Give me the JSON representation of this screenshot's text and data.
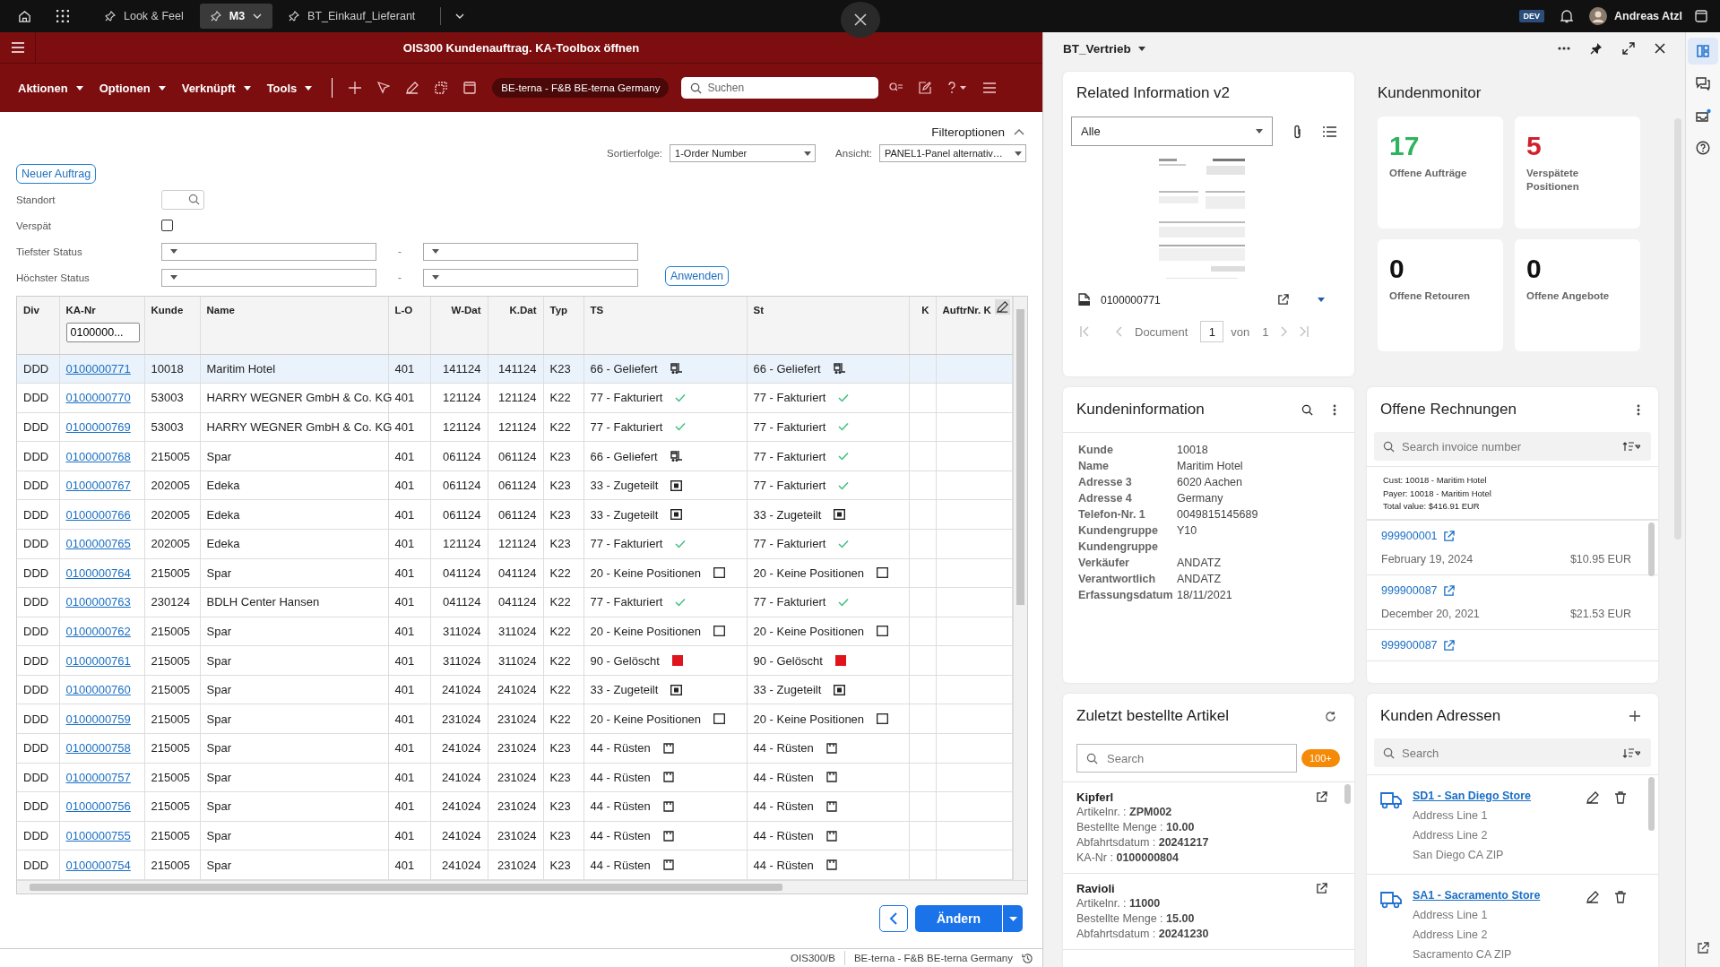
{
  "top_bar": {
    "tabs": [
      {
        "label": "Look & Feel",
        "selected": false
      },
      {
        "label": "M3",
        "selected": true
      },
      {
        "label": "BT_Einkauf_Lieferant",
        "selected": false
      }
    ],
    "env_badge": "DEV",
    "user": "Andreas Atzl"
  },
  "window": {
    "title": "OIS300 Kundenauftrag. KA-Toolbox öffnen"
  },
  "toolbar": {
    "menus": [
      "Aktionen",
      "Optionen",
      "Verknüpft",
      "Tools"
    ],
    "company": "BE-terna - F&B BE-terna Germany",
    "search": {
      "placeholder": "Suchen"
    }
  },
  "filters": {
    "toggle": "Filteroptionen",
    "expanded": true,
    "sort_label": "Sortierfolge:",
    "sort_value": "1-Order Number",
    "view_label": "Ansicht:",
    "view_value": "PANEL1-Panel alternativ…",
    "new_button": "Neuer Auftrag",
    "apply_button": "Anwenden",
    "fields": [
      {
        "label": "Standort",
        "kind": "search"
      },
      {
        "label": "Verspät",
        "kind": "checkbox",
        "checked": false
      },
      {
        "label": "Tiefster Status",
        "kind": "range",
        "separator": "-"
      },
      {
        "label": "Höchster Status",
        "kind": "range",
        "separator": "-"
      }
    ]
  },
  "table": {
    "columns": [
      "Div",
      "KA-Nr",
      "Kunde",
      "Name",
      "L-O",
      "W-Dat",
      "K.Dat",
      "Typ",
      "TS",
      "St",
      "K",
      "AuftrNr. K"
    ],
    "filter_value": "0100000...",
    "rows": [
      {
        "div": "DDD",
        "ka_nr": "0100000771",
        "kunde": "10018",
        "name": "Maritim Hotel",
        "lo": "401",
        "w_dat": "141124",
        "k_dat": "141124",
        "typ": "K23",
        "ts": {
          "label": "66 - Geliefert",
          "kind": "delivered"
        },
        "st": {
          "label": "66 - Geliefert",
          "kind": "delivered"
        },
        "selected": true
      },
      {
        "div": "DDD",
        "ka_nr": "0100000770",
        "kunde": "53003",
        "name": "HARRY WEGNER GmbH & Co. KG",
        "lo": "401",
        "w_dat": "121124",
        "k_dat": "121124",
        "typ": "K22",
        "ts": {
          "label": "77 - Fakturiert",
          "kind": "invoiced"
        },
        "st": {
          "label": "77 - Fakturiert",
          "kind": "invoiced"
        },
        "selected": false
      },
      {
        "div": "DDD",
        "ka_nr": "0100000769",
        "kunde": "53003",
        "name": "HARRY WEGNER GmbH & Co. KG",
        "lo": "401",
        "w_dat": "121124",
        "k_dat": "121124",
        "typ": "K22",
        "ts": {
          "label": "77 - Fakturiert",
          "kind": "invoiced"
        },
        "st": {
          "label": "77 - Fakturiert",
          "kind": "invoiced"
        },
        "selected": false
      },
      {
        "div": "DDD",
        "ka_nr": "0100000768",
        "kunde": "215005",
        "name": "Spar",
        "lo": "401",
        "w_dat": "061124",
        "k_dat": "061124",
        "typ": "K23",
        "ts": {
          "label": "66 - Geliefert",
          "kind": "delivered"
        },
        "st": {
          "label": "77 - Fakturiert",
          "kind": "invoiced"
        },
        "selected": false
      },
      {
        "div": "DDD",
        "ka_nr": "0100000767",
        "kunde": "202005",
        "name": "Edeka",
        "lo": "401",
        "w_dat": "061124",
        "k_dat": "061124",
        "typ": "K23",
        "ts": {
          "label": "33 - Zugeteilt",
          "kind": "assigned"
        },
        "st": {
          "label": "77 - Fakturiert",
          "kind": "invoiced"
        },
        "selected": false
      },
      {
        "div": "DDD",
        "ka_nr": "0100000766",
        "kunde": "202005",
        "name": "Edeka",
        "lo": "401",
        "w_dat": "061124",
        "k_dat": "061124",
        "typ": "K23",
        "ts": {
          "label": "33 - Zugeteilt",
          "kind": "assigned"
        },
        "st": {
          "label": "33 - Zugeteilt",
          "kind": "assigned"
        },
        "selected": false
      },
      {
        "div": "DDD",
        "ka_nr": "0100000765",
        "kunde": "202005",
        "name": "Edeka",
        "lo": "401",
        "w_dat": "121124",
        "k_dat": "121124",
        "typ": "K23",
        "ts": {
          "label": "77 - Fakturiert",
          "kind": "invoiced"
        },
        "st": {
          "label": "77 - Fakturiert",
          "kind": "invoiced"
        },
        "selected": false
      },
      {
        "div": "DDD",
        "ka_nr": "0100000764",
        "kunde": "215005",
        "name": "Spar",
        "lo": "401",
        "w_dat": "041124",
        "k_dat": "041124",
        "typ": "K22",
        "ts": {
          "label": "20 - Keine Positionen",
          "kind": "empty"
        },
        "st": {
          "label": "20 - Keine Positionen",
          "kind": "empty"
        },
        "selected": false
      },
      {
        "div": "DDD",
        "ka_nr": "0100000763",
        "kunde": "230124",
        "name": "BDLH Center Hansen",
        "lo": "401",
        "w_dat": "041124",
        "k_dat": "041124",
        "typ": "K22",
        "ts": {
          "label": "77 - Fakturiert",
          "kind": "invoiced"
        },
        "st": {
          "label": "77 - Fakturiert",
          "kind": "invoiced"
        },
        "selected": false
      },
      {
        "div": "DDD",
        "ka_nr": "0100000762",
        "kunde": "215005",
        "name": "Spar",
        "lo": "401",
        "w_dat": "311024",
        "k_dat": "311024",
        "typ": "K22",
        "ts": {
          "label": "20 - Keine Positionen",
          "kind": "empty"
        },
        "st": {
          "label": "20 - Keine Positionen",
          "kind": "empty"
        },
        "selected": false
      },
      {
        "div": "DDD",
        "ka_nr": "0100000761",
        "kunde": "215005",
        "name": "Spar",
        "lo": "401",
        "w_dat": "311024",
        "k_dat": "311024",
        "typ": "K22",
        "ts": {
          "label": "90 - Gelöscht",
          "kind": "deleted"
        },
        "st": {
          "label": "90 - Gelöscht",
          "kind": "deleted"
        },
        "selected": false
      },
      {
        "div": "DDD",
        "ka_nr": "0100000760",
        "kunde": "215005",
        "name": "Spar",
        "lo": "401",
        "w_dat": "241024",
        "k_dat": "241024",
        "typ": "K22",
        "ts": {
          "label": "33 - Zugeteilt",
          "kind": "assigned"
        },
        "st": {
          "label": "33 - Zugeteilt",
          "kind": "assigned"
        },
        "selected": false
      },
      {
        "div": "DDD",
        "ka_nr": "0100000759",
        "kunde": "215005",
        "name": "Spar",
        "lo": "401",
        "w_dat": "231024",
        "k_dat": "231024",
        "typ": "K22",
        "ts": {
          "label": "20 - Keine Positionen",
          "kind": "empty"
        },
        "st": {
          "label": "20 - Keine Positionen",
          "kind": "empty"
        },
        "selected": false
      },
      {
        "div": "DDD",
        "ka_nr": "0100000758",
        "kunde": "215005",
        "name": "Spar",
        "lo": "401",
        "w_dat": "241024",
        "k_dat": "231024",
        "typ": "K23",
        "ts": {
          "label": "44 - Rüsten",
          "kind": "picking"
        },
        "st": {
          "label": "44 - Rüsten",
          "kind": "picking"
        },
        "selected": false
      },
      {
        "div": "DDD",
        "ka_nr": "0100000757",
        "kunde": "215005",
        "name": "Spar",
        "lo": "401",
        "w_dat": "241024",
        "k_dat": "231024",
        "typ": "K23",
        "ts": {
          "label": "44 - Rüsten",
          "kind": "picking"
        },
        "st": {
          "label": "44 - Rüsten",
          "kind": "picking"
        },
        "selected": false
      },
      {
        "div": "DDD",
        "ka_nr": "0100000756",
        "kunde": "215005",
        "name": "Spar",
        "lo": "401",
        "w_dat": "241024",
        "k_dat": "231024",
        "typ": "K23",
        "ts": {
          "label": "44 - Rüsten",
          "kind": "picking"
        },
        "st": {
          "label": "44 - Rüsten",
          "kind": "picking"
        },
        "selected": false
      },
      {
        "div": "DDD",
        "ka_nr": "0100000755",
        "kunde": "215005",
        "name": "Spar",
        "lo": "401",
        "w_dat": "241024",
        "k_dat": "231024",
        "typ": "K23",
        "ts": {
          "label": "44 - Rüsten",
          "kind": "picking"
        },
        "st": {
          "label": "44 - Rüsten",
          "kind": "picking"
        },
        "selected": false
      },
      {
        "div": "DDD",
        "ka_nr": "0100000754",
        "kunde": "215005",
        "name": "Spar",
        "lo": "401",
        "w_dat": "241024",
        "k_dat": "231024",
        "typ": "K23",
        "ts": {
          "label": "44 - Rüsten",
          "kind": "picking"
        },
        "st": {
          "label": "44 - Rüsten",
          "kind": "picking"
        },
        "selected": false
      }
    ]
  },
  "actions": {
    "primary": "Ändern"
  },
  "status_bar": {
    "program": "OIS300/B",
    "company": "BE-terna - F&B BE-terna Germany"
  },
  "side_panel": {
    "title": "BT_Vertrieb",
    "related": {
      "title": "Related Information v2",
      "filter": "Alle",
      "file": "0100000771",
      "pager_label": "Document",
      "page": "1",
      "of_label": "von",
      "pages": "1"
    },
    "monitor": {
      "title": "Kundenmonitor",
      "tiles": [
        {
          "value": "17",
          "label": "Offene Aufträge",
          "color": "#2fb35f"
        },
        {
          "value": "5",
          "label": "Verspätete Positionen",
          "color": "#d0202a"
        },
        {
          "value": "0",
          "label": "Offene Retouren",
          "color": "#111111"
        },
        {
          "value": "0",
          "label": "Offene Angebote",
          "color": "#111111"
        }
      ]
    },
    "customer_info": {
      "title": "Kundeninformation",
      "fields": [
        {
          "label": "Kunde",
          "value": "10018"
        },
        {
          "label": "Name",
          "value": "Maritim Hotel"
        },
        {
          "label": "Adresse 3",
          "value": "6020 Aachen"
        },
        {
          "label": "Adresse 4",
          "value": "Germany"
        },
        {
          "label": "Telefon-Nr. 1",
          "value": "0049815145689"
        },
        {
          "label": "Kundengruppe",
          "value": "Y10"
        },
        {
          "label": "Kundengruppe"
        },
        {
          "label": "Verkäufer",
          "value": "ANDATZ"
        },
        {
          "label": "Verantwortlich",
          "value": "ANDATZ"
        },
        {
          "label": "Erfassungsdatum",
          "value": "18/11/2021"
        }
      ]
    },
    "invoices": {
      "title": "Offene Rechnungen",
      "search": {
        "placeholder": "Search invoice number"
      },
      "summary": [
        "Cust: 10018 - Maritim Hotel",
        "Payer: 10018 - Maritim Hotel",
        "Total value: $416.91 EUR"
      ],
      "items": [
        {
          "number": "999900001",
          "date": "February 19, 2024",
          "amount": "$10.95 EUR"
        },
        {
          "number": "999900087",
          "date": "December 20, 2021",
          "amount": "$21.53 EUR"
        },
        {
          "number": "999900087"
        }
      ]
    },
    "recent_items": {
      "title": "Zuletzt bestellte Artikel",
      "search": {
        "placeholder": "Search"
      },
      "count_badge": "100+",
      "items": [
        {
          "name": "Kipferl",
          "fields": [
            {
              "label": "Artikelnr. :",
              "value": "ZPM002"
            },
            {
              "label": "Bestellte Menge :",
              "value": "10.00"
            },
            {
              "label": "Abfahrtsdatum :",
              "value": "20241217"
            },
            {
              "label": "KA-Nr :",
              "value": "0100000804"
            }
          ]
        },
        {
          "name": "Ravioli",
          "fields": [
            {
              "label": "Artikelnr. :",
              "value": "11000"
            },
            {
              "label": "Bestellte Menge :",
              "value": "15.00"
            },
            {
              "label": "Abfahrtsdatum :",
              "value": "20241230"
            }
          ]
        }
      ]
    },
    "addresses": {
      "title": "Kunden Adressen",
      "search": {
        "placeholder": "Search"
      },
      "items": [
        {
          "name": "SD1 - San Diego Store",
          "lines": [
            "Address Line 1",
            "Address Line 2",
            "San Diego CA ZIP"
          ]
        },
        {
          "name": "SA1 - Sacramento Store",
          "lines": [
            "Address Line 1",
            "Address Line 2",
            "Sacramento CA ZIP"
          ]
        }
      ]
    }
  },
  "right_rail": [
    {
      "kind": "layout",
      "selected": true
    },
    {
      "kind": "chat",
      "selected": false
    },
    {
      "kind": "inbox",
      "selected": false
    },
    {
      "kind": "help",
      "selected": false
    }
  ]
}
